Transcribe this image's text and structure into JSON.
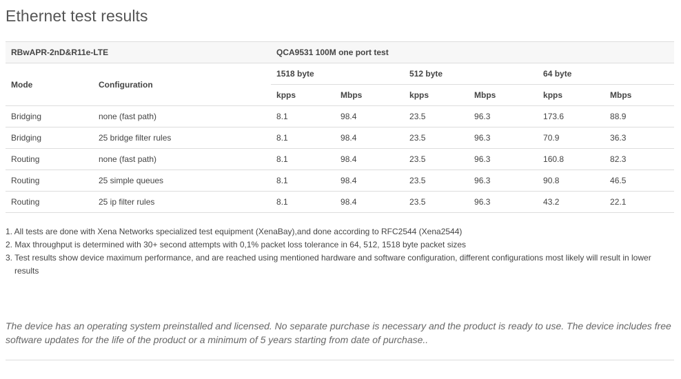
{
  "page": {
    "title": "Ethernet test results"
  },
  "table": {
    "model": "RBwAPR-2nD&R11e-LTE",
    "test_name": "QCA9531 100M one port test",
    "col_mode": "Mode",
    "col_configuration": "Configuration",
    "packet_sizes": [
      "1518 byte",
      "512 byte",
      "64 byte"
    ],
    "unit_kpps": "kpps",
    "unit_mbps": "Mbps",
    "rows": [
      {
        "mode": "Bridging",
        "config": "none (fast path)",
        "v": [
          "8.1",
          "98.4",
          "23.5",
          "96.3",
          "173.6",
          "88.9"
        ]
      },
      {
        "mode": "Bridging",
        "config": "25 bridge filter rules",
        "v": [
          "8.1",
          "98.4",
          "23.5",
          "96.3",
          "70.9",
          "36.3"
        ]
      },
      {
        "mode": "Routing",
        "config": "none (fast path)",
        "v": [
          "8.1",
          "98.4",
          "23.5",
          "96.3",
          "160.8",
          "82.3"
        ]
      },
      {
        "mode": "Routing",
        "config": "25 simple queues",
        "v": [
          "8.1",
          "98.4",
          "23.5",
          "96.3",
          "90.8",
          "46.5"
        ]
      },
      {
        "mode": "Routing",
        "config": "25 ip filter rules",
        "v": [
          "8.1",
          "98.4",
          "23.5",
          "96.3",
          "43.2",
          "22.1"
        ]
      }
    ]
  },
  "notes": [
    "1. All tests are done with Xena Networks specialized test equipment (XenaBay),and done according to RFC2544 (Xena2544)",
    "2. Max throughput is determined with 30+ second attempts with 0,1% packet loss tolerance in 64, 512, 1518 byte packet sizes",
    "3. Test results show device maximum performance, and are reached using mentioned hardware and software configuration, different configurations most likely will result in lower results"
  ],
  "disclaimer": "The device has an operating system preinstalled and licensed. No separate purchase is necessary and the product is ready to use. The device includes free software updates for the life of the product or a minimum of 5 years starting from date of purchase.."
}
